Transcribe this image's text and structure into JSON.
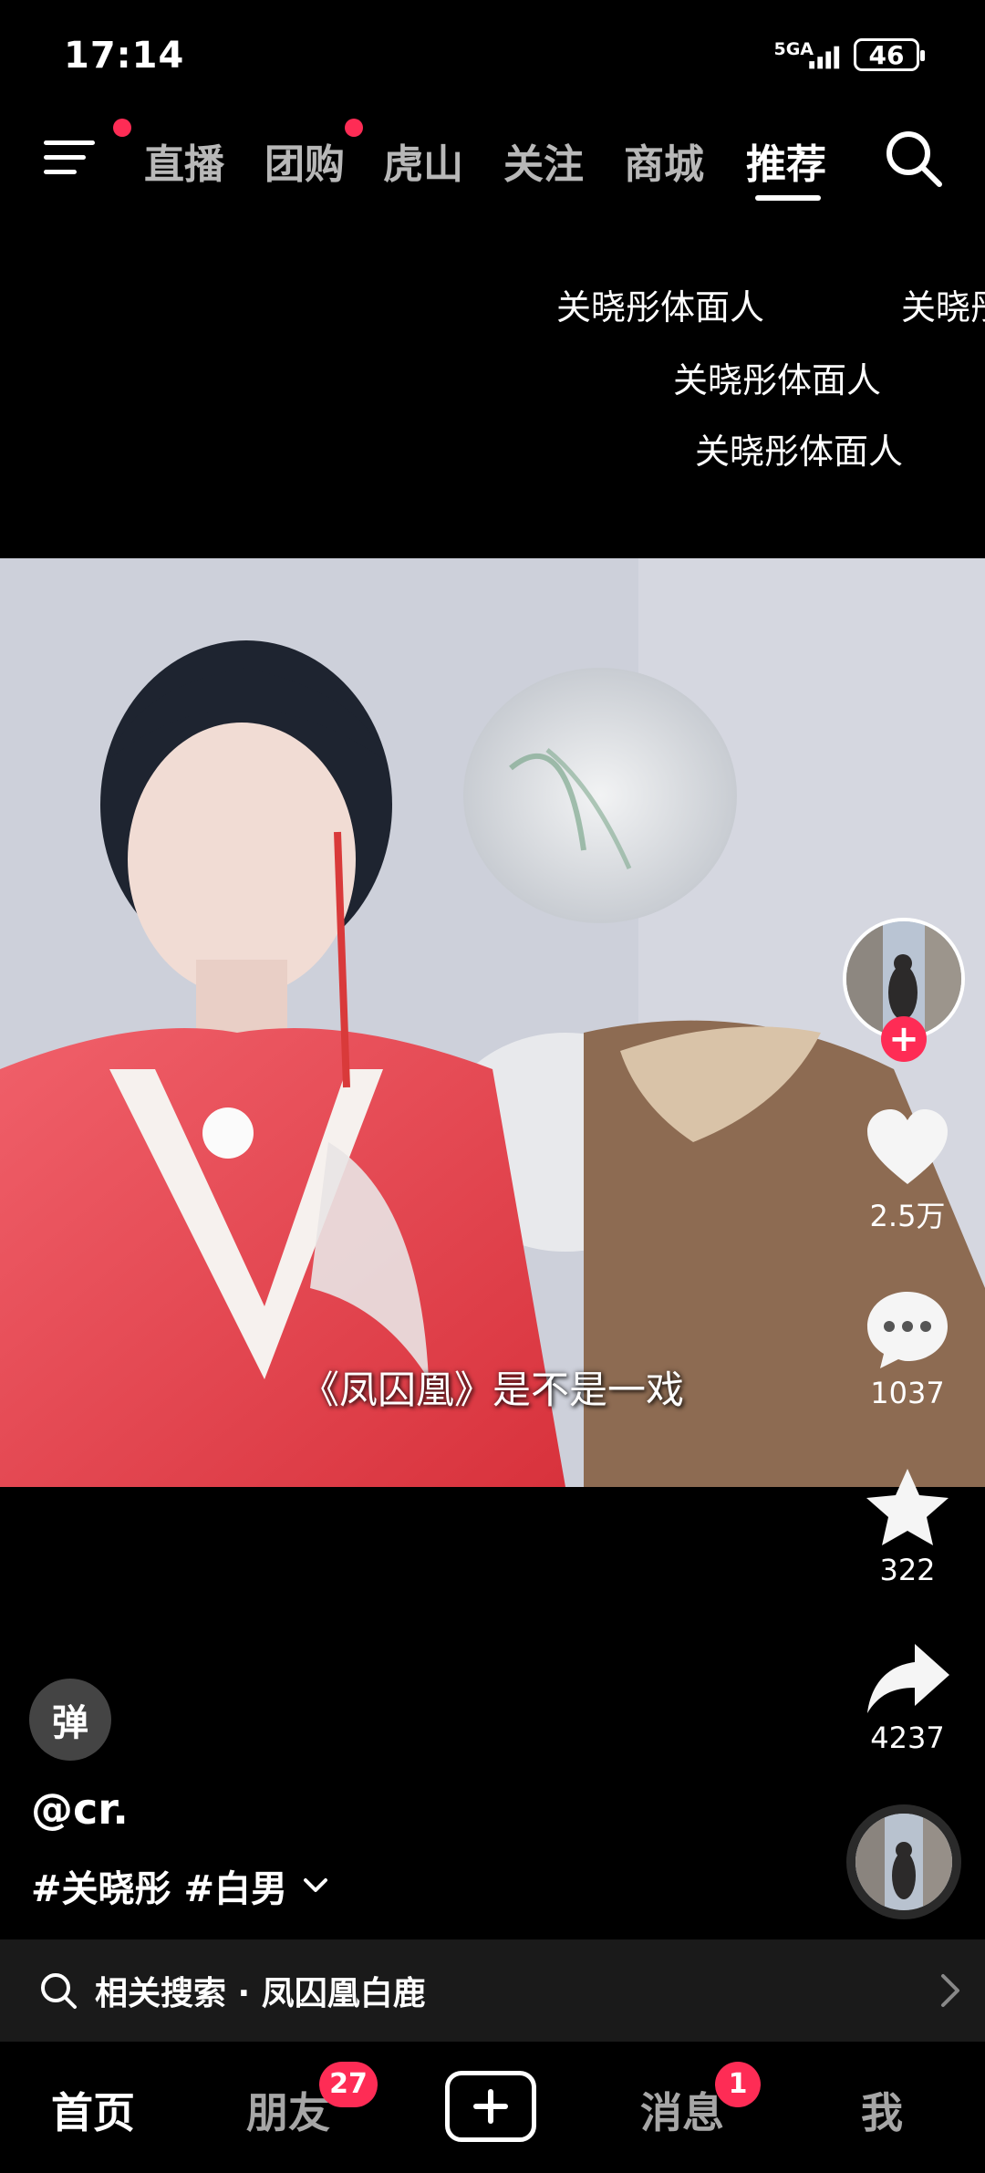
{
  "status_bar": {
    "time": "17:14",
    "network": "5GA",
    "battery": "46"
  },
  "top_nav": {
    "tabs": [
      {
        "label": "直播"
      },
      {
        "label": "团购"
      },
      {
        "label": "虎山"
      },
      {
        "label": "关注"
      },
      {
        "label": "商城"
      },
      {
        "label": "推荐"
      }
    ],
    "active_tab": "推荐"
  },
  "danmaku": [
    "关晓彤体面人",
    "关晓彤",
    "关晓彤体面人",
    "关晓彤体面人"
  ],
  "video": {
    "subtitle": "《凤囚凰》是不是一戏"
  },
  "actions": {
    "likes": "2.5万",
    "comments": "1037",
    "favorites": "322",
    "shares": "4237"
  },
  "danmu_toggle_label": "弹",
  "post": {
    "username": "@cr.",
    "hashtags": "#关晓彤 #白男"
  },
  "related_search": {
    "label": "相关搜索 · 凤囚凰白鹿"
  },
  "bottom_nav": {
    "items": [
      {
        "label": "首页"
      },
      {
        "label": "朋友",
        "badge": "27"
      },
      {
        "label": "消息",
        "badge": "1"
      },
      {
        "label": "我"
      }
    ]
  },
  "colors": {
    "accent": "#fe2c55",
    "background": "#000000",
    "related_bar": "#1a1a1a"
  }
}
